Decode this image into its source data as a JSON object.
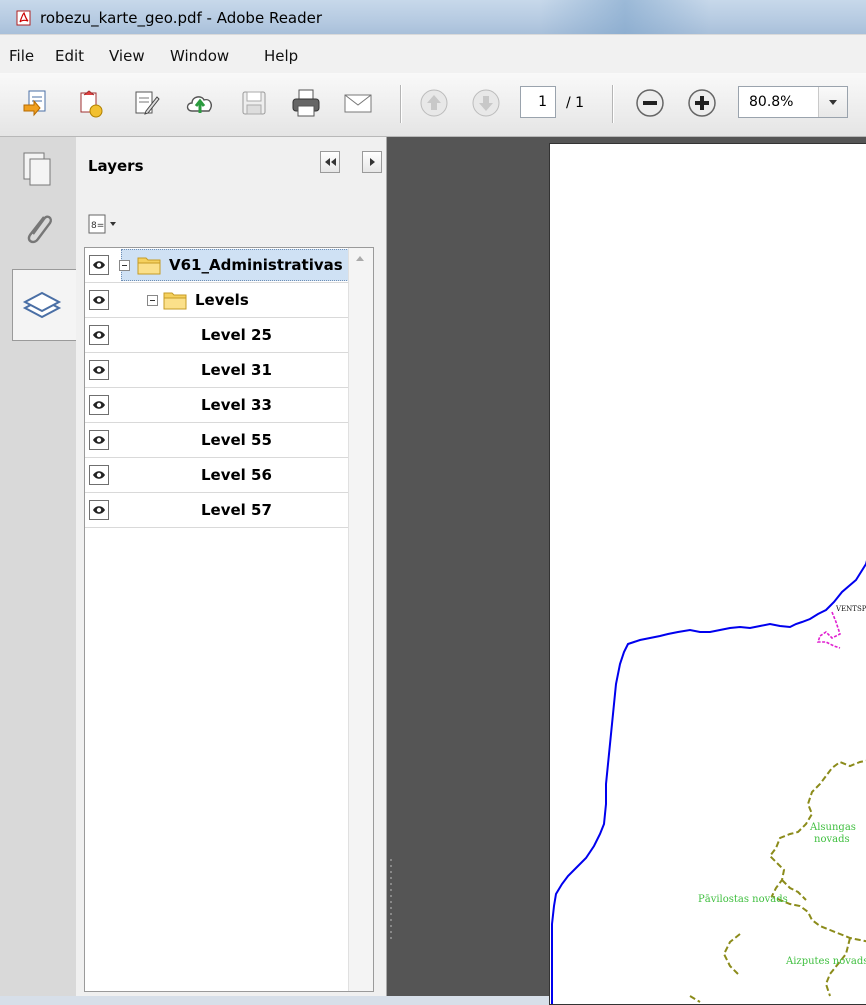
{
  "window": {
    "title": "robezu_karte_geo.pdf - Adobe Reader"
  },
  "menu": {
    "items": [
      "File",
      "Edit",
      "View",
      "Window",
      "Help"
    ]
  },
  "toolbar": {
    "page_number": "1",
    "page_total": "/ 1",
    "zoom": "80.8%"
  },
  "layers_panel": {
    "title": "Layers",
    "rows": [
      {
        "label": "V61_Administrativas",
        "level": 0,
        "expandable": true,
        "folder": true,
        "selected": true
      },
      {
        "label": "Levels",
        "level": 1,
        "expandable": true,
        "folder": true,
        "selected": false
      },
      {
        "label": "Level 25",
        "level": 2,
        "expandable": false,
        "folder": false,
        "selected": false
      },
      {
        "label": "Level 31",
        "level": 2,
        "expandable": false,
        "folder": false,
        "selected": false
      },
      {
        "label": "Level 33",
        "level": 2,
        "expandable": false,
        "folder": false,
        "selected": false
      },
      {
        "label": "Level 55",
        "level": 2,
        "expandable": false,
        "folder": false,
        "selected": false
      },
      {
        "label": "Level 56",
        "level": 2,
        "expandable": false,
        "folder": false,
        "selected": false
      },
      {
        "label": "Level 57",
        "level": 2,
        "expandable": false,
        "folder": false,
        "selected": false
      }
    ]
  },
  "map": {
    "labels": {
      "ventspils": "VENTSP",
      "alsungas_1": "Alsungas",
      "alsungas_2": "novads",
      "pavilostas": "Pāvilostas novads",
      "aizputes": "Aizputes novads"
    },
    "colors": {
      "coast": "#0000ee",
      "municipal_border": "#8b8b1a",
      "city_border": "#e020d0",
      "label": "#3fbf3f"
    }
  }
}
